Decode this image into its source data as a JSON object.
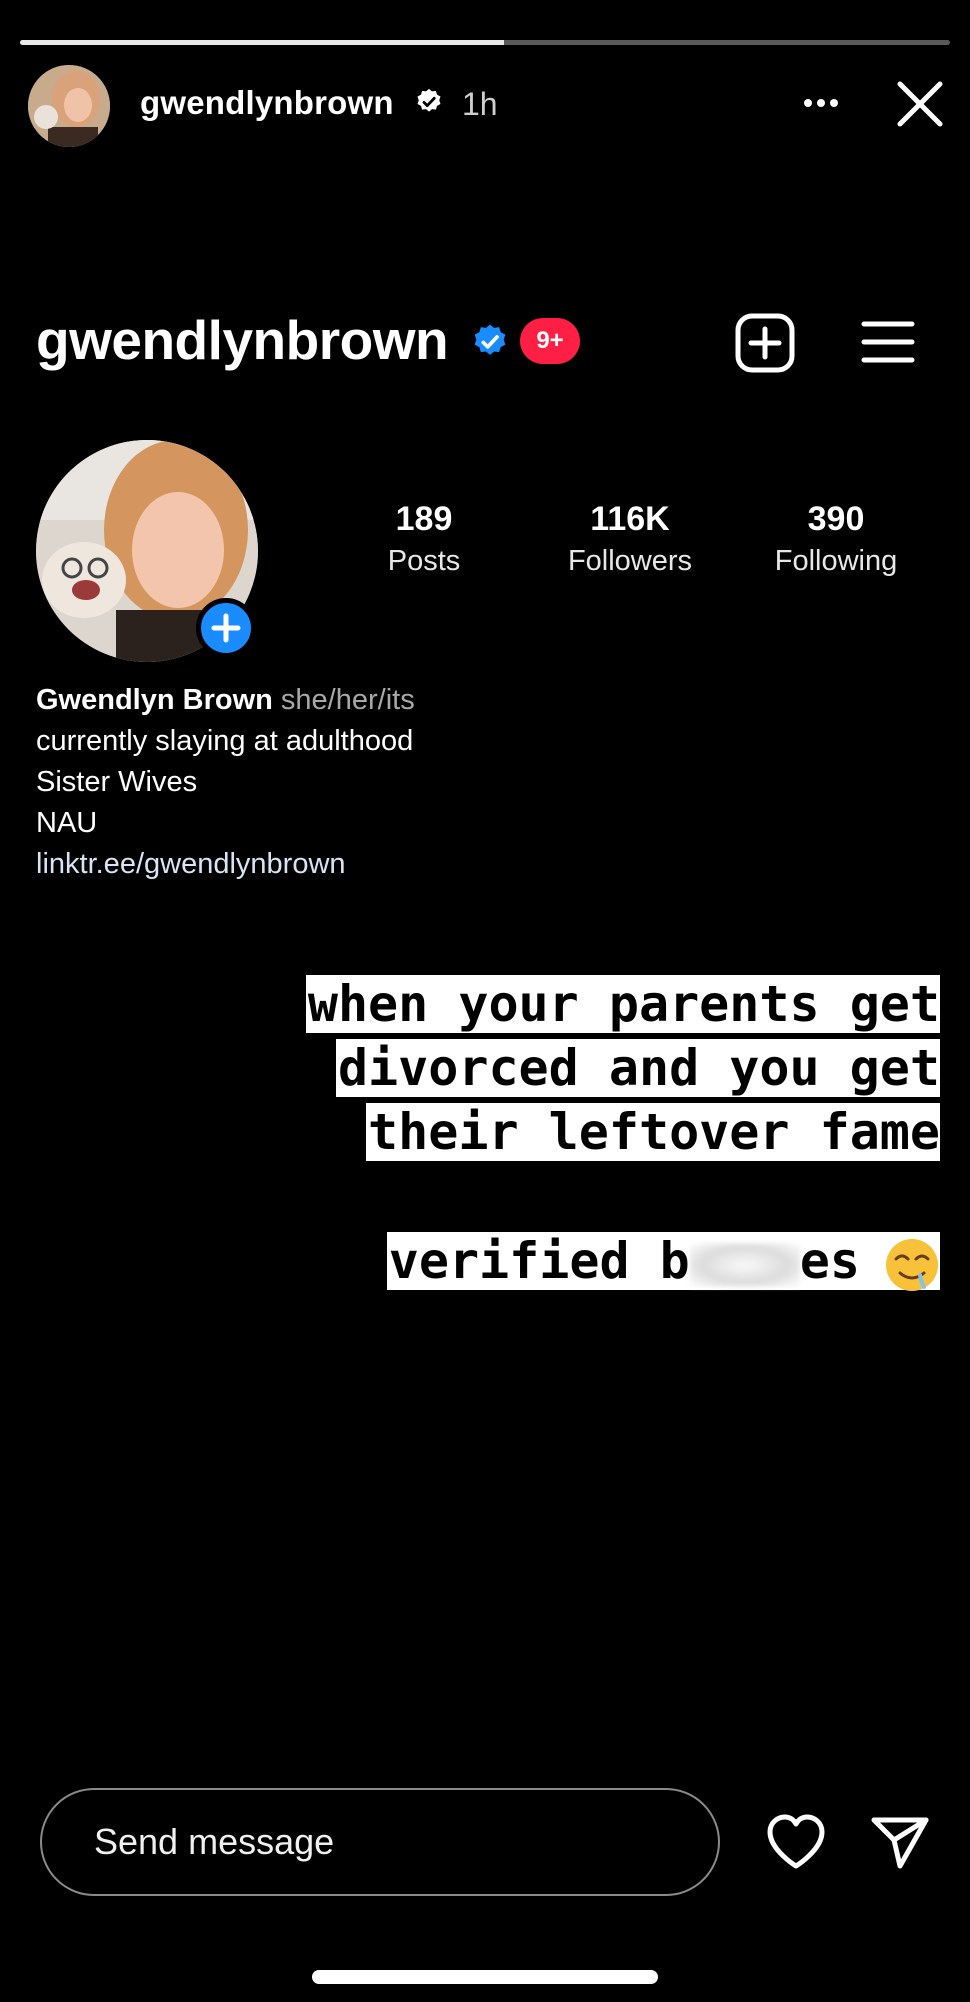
{
  "story": {
    "progress_fraction": 0.52,
    "username": "gwendlynbrown",
    "time": "1h",
    "avatar_icon": "story-avatar-photo",
    "more_icon": "more-horizontal-icon",
    "close_icon": "close-icon"
  },
  "profile": {
    "username": "gwendlynbrown",
    "verified": true,
    "notification_badge": "9+",
    "stats": [
      {
        "value": "189",
        "label": "Posts"
      },
      {
        "value": "116K",
        "label": "Followers"
      },
      {
        "value": "390",
        "label": "Following"
      }
    ],
    "bio": {
      "name": "Gwendlyn Brown",
      "pronouns": "she/her/its",
      "lines": [
        "currently slaying at adulthood",
        "Sister Wives",
        "NAU"
      ],
      "link": "linktr.ee/gwendlynbrown"
    }
  },
  "caption": {
    "lines": [
      "when your parents get",
      "divorced and you get",
      "their leftover fame"
    ],
    "second_prefix": "verified b",
    "second_suffix": "es",
    "emoji": "drooling-face"
  },
  "composer": {
    "placeholder": "Send message"
  },
  "colors": {
    "background": "#000000",
    "verified_blue": "#1a8cff",
    "badge_red": "#ff1f45"
  }
}
